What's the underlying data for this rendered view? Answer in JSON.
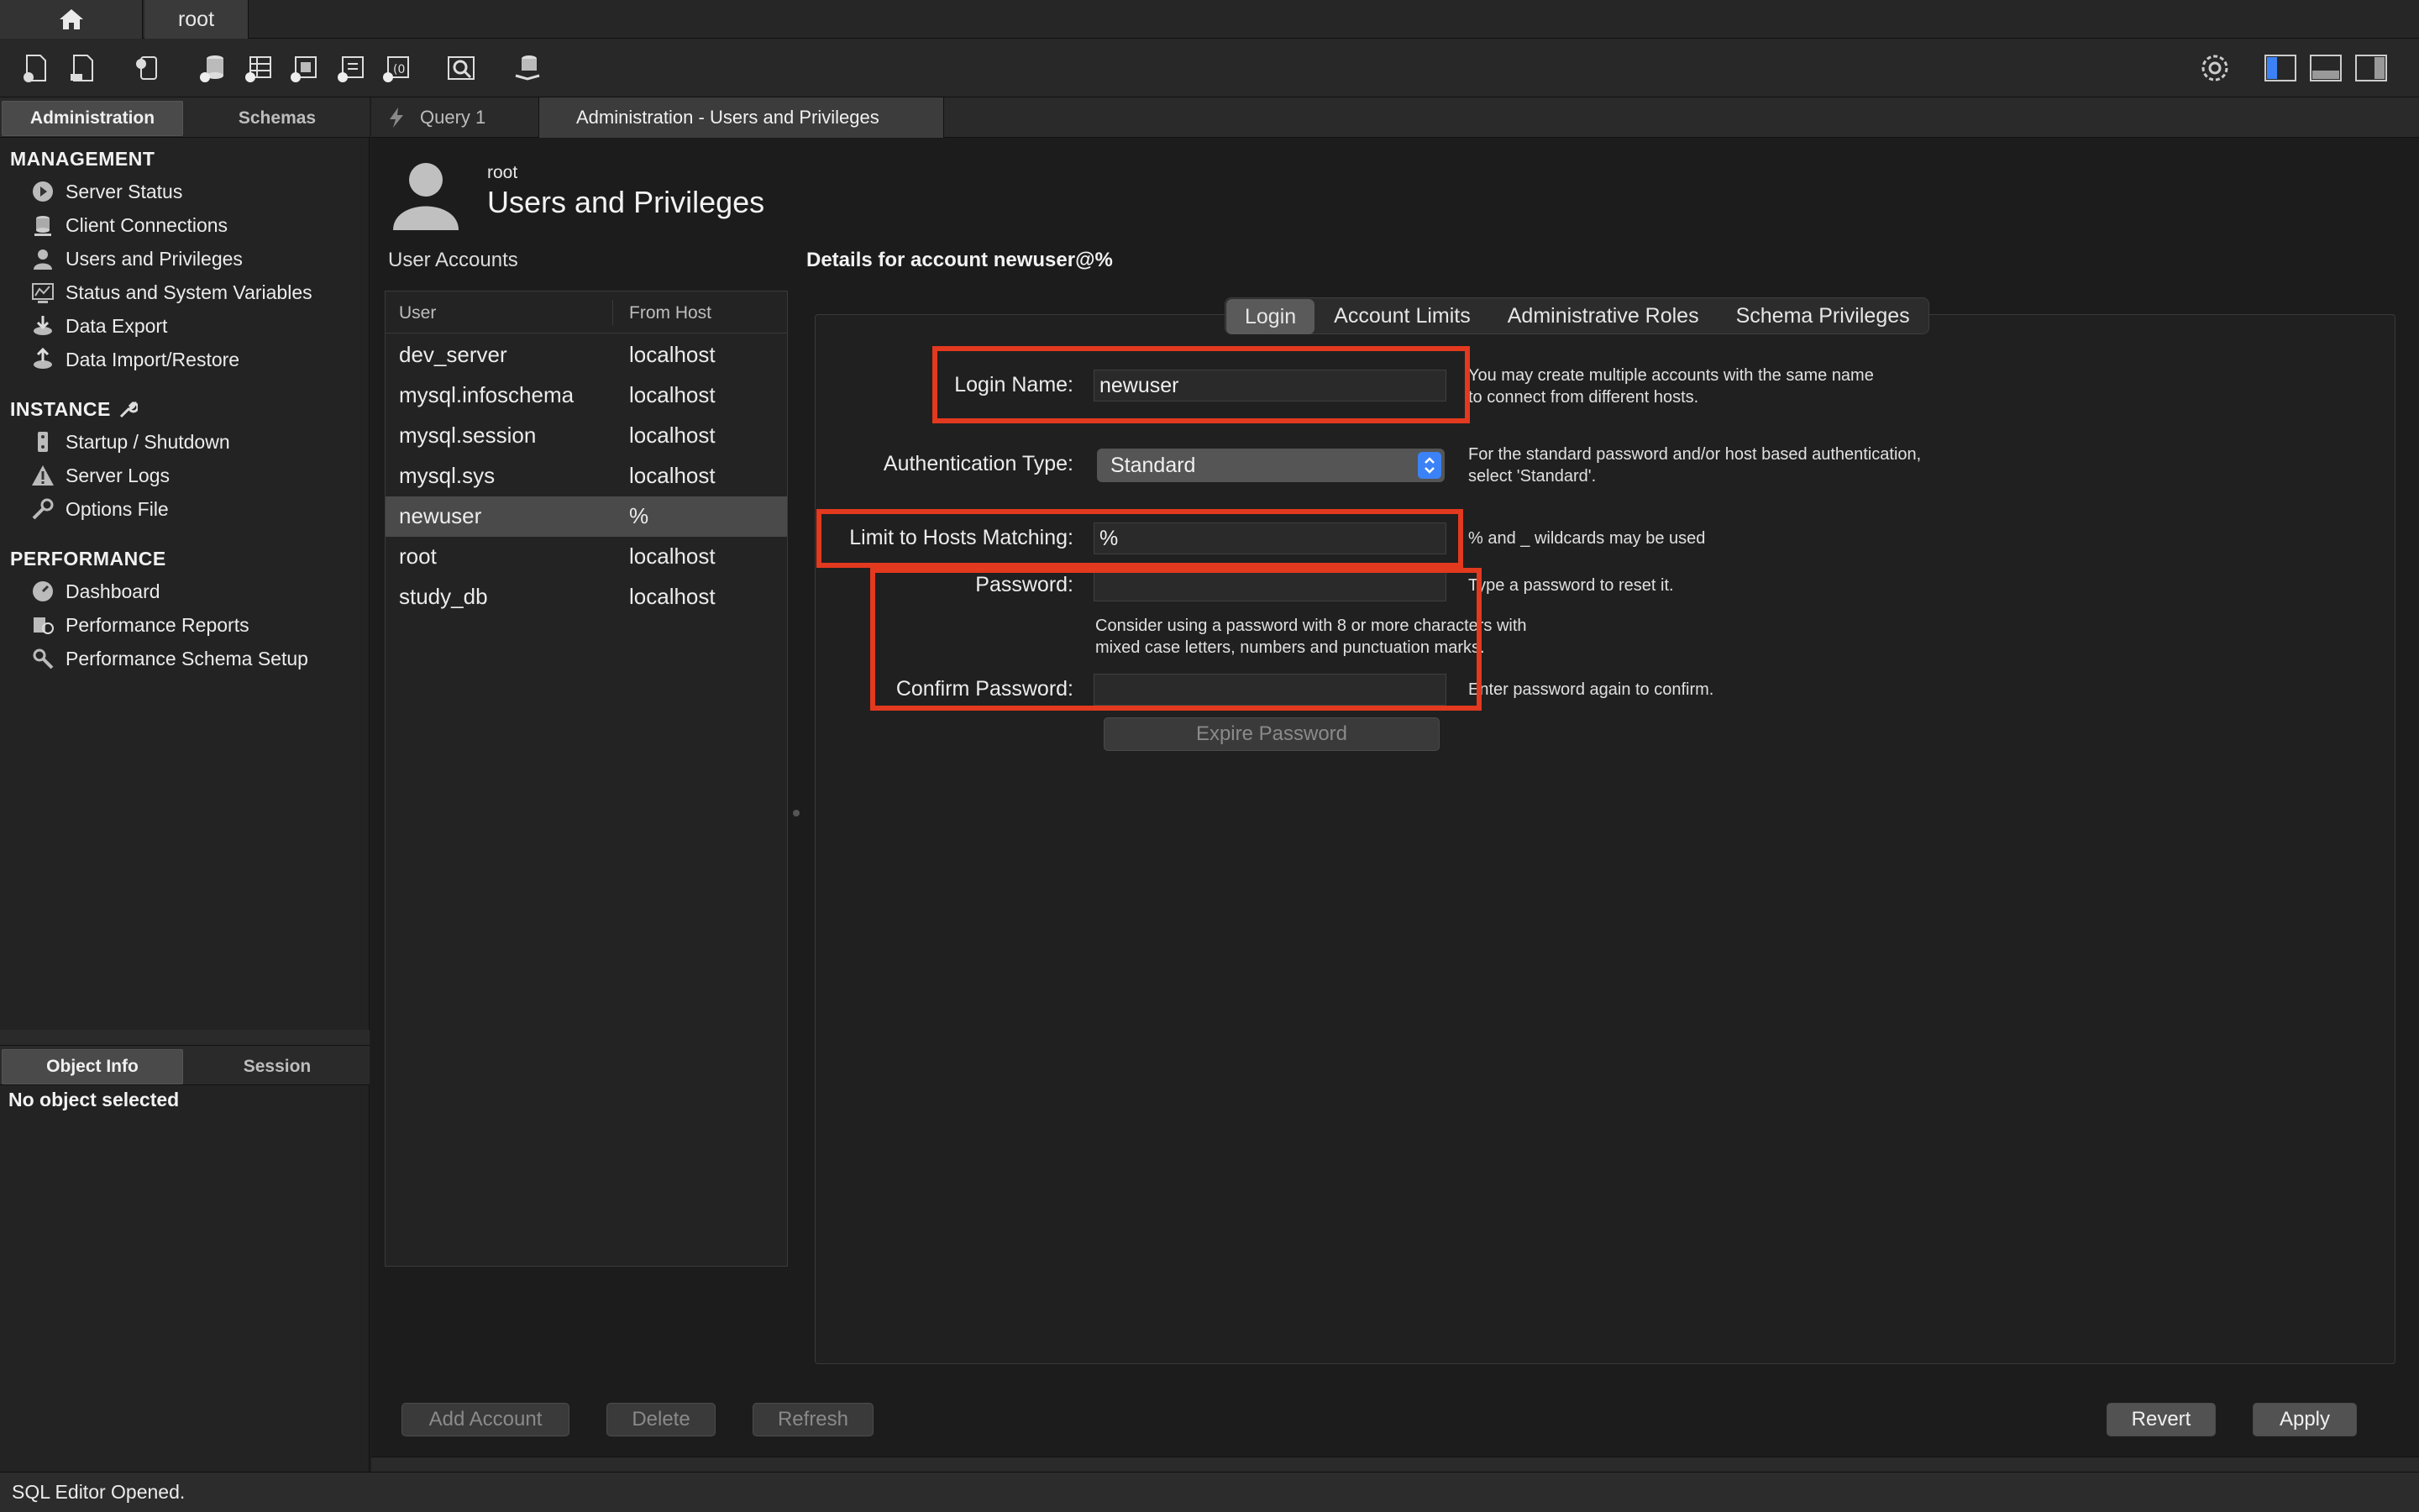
{
  "connection_tabs": {
    "home_icon": "home-icon",
    "connection": "root"
  },
  "toolbar": {
    "icons": [
      "new-sql-tab-icon",
      "open-sql-script-icon",
      "inspector-icon",
      "create-schema-icon",
      "create-table-icon",
      "create-view-icon",
      "create-procedure-icon",
      "create-function-icon",
      "search-table-data-icon",
      "reconnect-icon"
    ],
    "right_icons": [
      "settings-icon",
      "toggle-sidebar-icon",
      "toggle-output-icon",
      "toggle-secondary-sidebar-icon"
    ]
  },
  "sidebar": {
    "tabs": {
      "administration": "Administration",
      "schemas": "Schemas"
    },
    "management": {
      "header": "MANAGEMENT",
      "items": [
        {
          "label": "Server Status",
          "icon": "server-status-icon"
        },
        {
          "label": "Client Connections",
          "icon": "client-connections-icon"
        },
        {
          "label": "Users and Privileges",
          "icon": "users-icon"
        },
        {
          "label": "Status and System Variables",
          "icon": "system-variables-icon"
        },
        {
          "label": "Data Export",
          "icon": "data-export-icon"
        },
        {
          "label": "Data Import/Restore",
          "icon": "data-import-icon"
        }
      ]
    },
    "instance": {
      "header": "INSTANCE",
      "items": [
        {
          "label": "Startup / Shutdown",
          "icon": "startup-icon"
        },
        {
          "label": "Server Logs",
          "icon": "warning-icon"
        },
        {
          "label": "Options File",
          "icon": "wrench-icon"
        }
      ]
    },
    "performance": {
      "header": "PERFORMANCE",
      "items": [
        {
          "label": "Dashboard",
          "icon": "dashboard-icon"
        },
        {
          "label": "Performance Reports",
          "icon": "reports-icon"
        },
        {
          "label": "Performance Schema Setup",
          "icon": "schema-setup-icon"
        }
      ]
    },
    "bottom_tabs": {
      "object_info": "Object Info",
      "session": "Session"
    },
    "no_object": "No object selected"
  },
  "editor_tabs": {
    "query": "Query 1",
    "admin": "Administration - Users and Privileges"
  },
  "page": {
    "subtitle": "root",
    "title": "Users and Privileges"
  },
  "user_accounts": {
    "label": "User Accounts",
    "columns": {
      "user": "User",
      "host": "From Host"
    },
    "rows": [
      {
        "user": "dev_server",
        "host": "localhost"
      },
      {
        "user": "mysql.infoschema",
        "host": "localhost"
      },
      {
        "user": "mysql.session",
        "host": "localhost"
      },
      {
        "user": "mysql.sys",
        "host": "localhost"
      },
      {
        "user": "newuser",
        "host": "%"
      },
      {
        "user": "root",
        "host": "localhost"
      },
      {
        "user": "study_db",
        "host": "localhost"
      }
    ],
    "selected_index": 4
  },
  "details": {
    "heading": "Details for account newuser@%",
    "tabs": [
      "Login",
      "Account Limits",
      "Administrative Roles",
      "Schema Privileges"
    ],
    "active_tab": "Login",
    "login_name": {
      "label": "Login Name:",
      "value": "newuser",
      "hint1": "You may create multiple accounts with the same name",
      "hint2": "to connect from different hosts."
    },
    "auth_type": {
      "label": "Authentication Type:",
      "value": "Standard",
      "hint1": "For the standard password and/or host based authentication,",
      "hint2": "select 'Standard'."
    },
    "host_match": {
      "label": "Limit to Hosts Matching:",
      "value": "%",
      "hint": "% and _ wildcards may be used"
    },
    "password": {
      "label": "Password:",
      "value": "",
      "hint": "Type a password to reset it.",
      "note1": "Consider using a password with 8 or more characters with",
      "note2": "mixed case letters, numbers and punctuation marks."
    },
    "confirm": {
      "label": "Confirm Password:",
      "value": "",
      "hint": "Enter password again to confirm."
    },
    "expire_button": "Expire Password"
  },
  "buttons": {
    "add": "Add Account",
    "delete": "Delete",
    "refresh": "Refresh",
    "revert": "Revert",
    "apply": "Apply"
  },
  "status_bar": "SQL Editor Opened.",
  "colors": {
    "highlight": "#e2391f",
    "select_accent": "#3b82f6"
  }
}
